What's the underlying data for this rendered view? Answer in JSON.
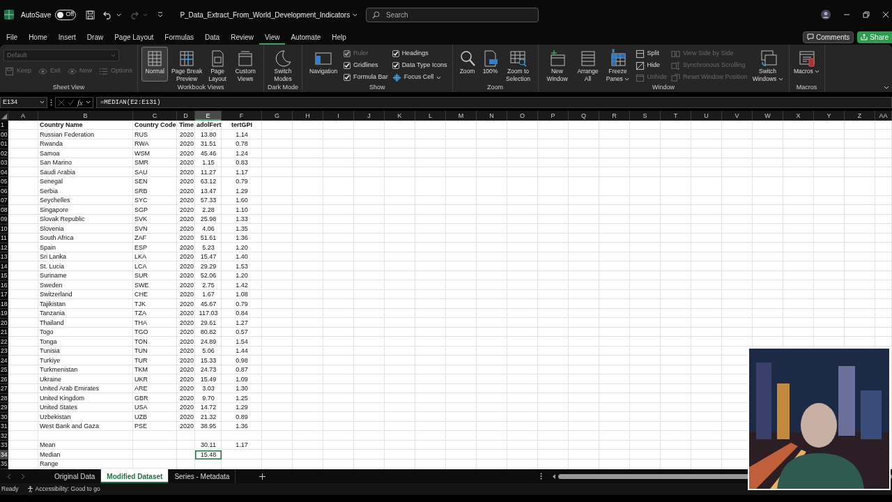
{
  "title_bar": {
    "autosave_label": "AutoSave",
    "autosave": {
      "on": false,
      "text": "Off"
    },
    "filename": "P_Data_Extract_From_World_Development_Indicators",
    "search": {
      "placeholder": "Search"
    }
  },
  "menu_tabs": [
    {
      "label": "File",
      "selected": false
    },
    {
      "label": "Home",
      "selected": false
    },
    {
      "label": "Insert",
      "selected": false
    },
    {
      "label": "Draw",
      "selected": false
    },
    {
      "label": "Page Layout",
      "selected": false
    },
    {
      "label": "Formulas",
      "selected": false
    },
    {
      "label": "Data",
      "selected": false
    },
    {
      "label": "Review",
      "selected": false
    },
    {
      "label": "View",
      "selected": true
    },
    {
      "label": "Automate",
      "selected": false
    },
    {
      "label": "Help",
      "selected": false
    }
  ],
  "comments_button": "Comments",
  "share_button": "Share",
  "ribbon": {
    "groups": [
      {
        "label": "Sheet View",
        "items": [
          {
            "kind": "select",
            "value": "Default",
            "disabled": true
          },
          {
            "kind": "small",
            "label": "Keep",
            "disabled": true
          },
          {
            "kind": "small",
            "label": "Exit",
            "disabled": true
          },
          {
            "kind": "small",
            "label": "New",
            "disabled": true
          },
          {
            "kind": "small",
            "label": "Options",
            "disabled": true
          }
        ]
      },
      {
        "label": "Workbook Views",
        "items": [
          {
            "kind": "large",
            "label": "Normal",
            "selected": true
          },
          {
            "kind": "large",
            "label": "Page Break Preview",
            "selected": false
          },
          {
            "kind": "large",
            "label": "Page Layout",
            "selected": false
          },
          {
            "kind": "large",
            "label": "Custom Views",
            "selected": false
          }
        ]
      },
      {
        "label": "Dark Mode",
        "items": [
          {
            "kind": "large",
            "label": "Switch Modes"
          }
        ]
      },
      {
        "label": "Show",
        "items": [
          {
            "kind": "large",
            "label": "Navigation"
          },
          {
            "kind": "check",
            "label": "Ruler",
            "checked": true,
            "disabled": true
          },
          {
            "kind": "check",
            "label": "Gridlines",
            "checked": true
          },
          {
            "kind": "check",
            "label": "Formula Bar",
            "checked": true
          },
          {
            "kind": "check",
            "label": "Headings",
            "checked": true
          },
          {
            "kind": "check",
            "label": "Data Type Icons",
            "checked": true
          },
          {
            "kind": "small",
            "label": "Focus Cell",
            "has_menu": true
          }
        ]
      },
      {
        "label": "Zoom",
        "items": [
          {
            "kind": "large",
            "label": "Zoom"
          },
          {
            "kind": "large",
            "label": "100%"
          },
          {
            "kind": "large",
            "label": "Zoom to Selection"
          }
        ]
      },
      {
        "label": "Window",
        "items": [
          {
            "kind": "large",
            "label": "New Window"
          },
          {
            "kind": "large",
            "label": "Arrange All"
          },
          {
            "kind": "large",
            "label": "Freeze Panes",
            "has_menu": true
          },
          {
            "kind": "small",
            "label": "Split"
          },
          {
            "kind": "small",
            "label": "Hide"
          },
          {
            "kind": "small",
            "label": "Unhide",
            "disabled": true
          },
          {
            "kind": "small",
            "label": "View Side by Side",
            "disabled": true
          },
          {
            "kind": "small",
            "label": "Synchronous Scrolling",
            "disabled": true
          },
          {
            "kind": "small",
            "label": "Reset Window Position",
            "disabled": true
          },
          {
            "kind": "large",
            "label": "Switch Windows",
            "has_menu": true
          }
        ]
      },
      {
        "label": "Macros",
        "items": [
          {
            "kind": "large",
            "label": "Macros",
            "has_menu": true
          }
        ]
      }
    ]
  },
  "formula_bar": {
    "name_box": "E134",
    "function_button": "fx",
    "formula": "=MEDIAN(E2:E131)"
  },
  "sheet": {
    "columns": [
      {
        "label": "A",
        "selected": false
      },
      {
        "label": "B",
        "selected": false
      },
      {
        "label": "C",
        "selected": false
      },
      {
        "label": "D",
        "selected": false
      },
      {
        "label": "E",
        "selected": true
      },
      {
        "label": "F",
        "selected": false
      },
      {
        "label": "G",
        "selected": false
      },
      {
        "label": "H",
        "selected": false
      },
      {
        "label": "I",
        "selected": false
      },
      {
        "label": "J",
        "selected": false
      },
      {
        "label": "K",
        "selected": false
      },
      {
        "label": "L",
        "selected": false
      },
      {
        "label": "M",
        "selected": false
      },
      {
        "label": "N",
        "selected": false
      },
      {
        "label": "O",
        "selected": false
      },
      {
        "label": "P",
        "selected": false
      },
      {
        "label": "Q",
        "selected": false
      },
      {
        "label": "R",
        "selected": false
      },
      {
        "label": "S",
        "selected": false
      },
      {
        "label": "T",
        "selected": false
      },
      {
        "label": "U",
        "selected": false
      },
      {
        "label": "V",
        "selected": false
      },
      {
        "label": "W",
        "selected": false
      },
      {
        "label": "X",
        "selected": false
      },
      {
        "label": "Y",
        "selected": false
      },
      {
        "label": "Z",
        "selected": false
      },
      {
        "label": "AA",
        "selected": false
      }
    ],
    "rows": [
      {
        "number": "1",
        "selected": false,
        "kind": "header",
        "B": "Country Name",
        "C": "Country Code",
        "D": "Time",
        "E": "adolFert",
        "F": "tertGPI"
      },
      {
        "number": "00",
        "selected": false,
        "B": "Russian Federation",
        "C": "RUS",
        "D": "2020",
        "E": "13.80",
        "F": "1.14"
      },
      {
        "number": "01",
        "selected": false,
        "B": "Rwanda",
        "C": "RWA",
        "D": "2020",
        "E": "31.51",
        "F": "0.78"
      },
      {
        "number": "02",
        "selected": false,
        "B": "Samoa",
        "C": "WSM",
        "D": "2020",
        "E": "45.46",
        "F": "1.24"
      },
      {
        "number": "03",
        "selected": false,
        "B": "San Marino",
        "C": "SMR",
        "D": "2020",
        "E": "1.15",
        "F": "0.83"
      },
      {
        "number": "04",
        "selected": false,
        "B": "Saudi Arabia",
        "C": "SAU",
        "D": "2020",
        "E": "11.27",
        "F": "1.17"
      },
      {
        "number": "05",
        "selected": false,
        "B": "Senegal",
        "C": "SEN",
        "D": "2020",
        "E": "63.12",
        "F": "0.79"
      },
      {
        "number": "06",
        "selected": false,
        "B": "Serbia",
        "C": "SRB",
        "D": "2020",
        "E": "13.47",
        "F": "1.29"
      },
      {
        "number": "07",
        "selected": false,
        "B": "Seychelles",
        "C": "SYC",
        "D": "2020",
        "E": "57.33",
        "F": "1.60"
      },
      {
        "number": "08",
        "selected": false,
        "B": "Singapore",
        "C": "SGP",
        "D": "2020",
        "E": "2.28",
        "F": "1.10"
      },
      {
        "number": "09",
        "selected": false,
        "B": "Slovak Republic",
        "C": "SVK",
        "D": "2020",
        "E": "25.98",
        "F": "1.33"
      },
      {
        "number": "10",
        "selected": false,
        "B": "Slovenia",
        "C": "SVN",
        "D": "2020",
        "E": "4.06",
        "F": "1.35"
      },
      {
        "number": "11",
        "selected": false,
        "B": "South Africa",
        "C": "ZAF",
        "D": "2020",
        "E": "51.61",
        "F": "1.36"
      },
      {
        "number": "12",
        "selected": false,
        "B": "Spain",
        "C": "ESP",
        "D": "2020",
        "E": "5.23",
        "F": "1.20"
      },
      {
        "number": "13",
        "selected": false,
        "B": "Sri Lanka",
        "C": "LKA",
        "D": "2020",
        "E": "15.47",
        "F": "1.40"
      },
      {
        "number": "14",
        "selected": false,
        "B": "St. Lucia",
        "C": "LCA",
        "D": "2020",
        "E": "29.29",
        "F": "1.53"
      },
      {
        "number": "15",
        "selected": false,
        "B": "Suriname",
        "C": "SUR",
        "D": "2020",
        "E": "52.06",
        "F": "1.20"
      },
      {
        "number": "16",
        "selected": false,
        "B": "Sweden",
        "C": "SWE",
        "D": "2020",
        "E": "2.75",
        "F": "1.42"
      },
      {
        "number": "17",
        "selected": false,
        "B": "Switzerland",
        "C": "CHE",
        "D": "2020",
        "E": "1.67",
        "F": "1.08"
      },
      {
        "number": "18",
        "selected": false,
        "B": "Tajikistan",
        "C": "TJK",
        "D": "2020",
        "E": "45.67",
        "F": "0.79"
      },
      {
        "number": "19",
        "selected": false,
        "B": "Tanzania",
        "C": "TZA",
        "D": "2020",
        "E": "117.03",
        "F": "0.84"
      },
      {
        "number": "20",
        "selected": false,
        "B": "Thailand",
        "C": "THA",
        "D": "2020",
        "E": "29.61",
        "F": "1.27"
      },
      {
        "number": "21",
        "selected": false,
        "B": "Togo",
        "C": "TGO",
        "D": "2020",
        "E": "80.82",
        "F": "0.57"
      },
      {
        "number": "22",
        "selected": false,
        "B": "Tonga",
        "C": "TON",
        "D": "2020",
        "E": "24.89",
        "F": "1.54"
      },
      {
        "number": "23",
        "selected": false,
        "B": "Tunisia",
        "C": "TUN",
        "D": "2020",
        "E": "5.06",
        "F": "1.44"
      },
      {
        "number": "24",
        "selected": false,
        "B": "Turkiye",
        "C": "TUR",
        "D": "2020",
        "E": "15.33",
        "F": "0.98"
      },
      {
        "number": "25",
        "selected": false,
        "B": "Turkmenistan",
        "C": "TKM",
        "D": "2020",
        "E": "24.73",
        "F": "0.87"
      },
      {
        "number": "26",
        "selected": false,
        "B": "Ukraine",
        "C": "UKR",
        "D": "2020",
        "E": "15.49",
        "F": "1.09"
      },
      {
        "number": "27",
        "selected": false,
        "B": "United Arab Emirates",
        "C": "ARE",
        "D": "2020",
        "E": "3.03",
        "F": "1.30"
      },
      {
        "number": "28",
        "selected": false,
        "B": "United Kingdom",
        "C": "GBR",
        "D": "2020",
        "E": "9.70",
        "F": "1.25"
      },
      {
        "number": "29",
        "selected": false,
        "B": "United States",
        "C": "USA",
        "D": "2020",
        "E": "14.72",
        "F": "1.29"
      },
      {
        "number": "30",
        "selected": false,
        "B": "Uzbekistan",
        "C": "UZB",
        "D": "2020",
        "E": "21.32",
        "F": "0.89"
      },
      {
        "number": "31",
        "selected": false,
        "B": "West Bank and Gaza",
        "C": "PSE",
        "D": "2020",
        "E": "38.95",
        "F": "1.36"
      },
      {
        "number": "32",
        "selected": false
      },
      {
        "number": "33",
        "selected": false,
        "B": "Mean",
        "E": "30.11",
        "F": "1.17"
      },
      {
        "number": "34",
        "selected": true,
        "B": "Median",
        "E": "15.48"
      },
      {
        "number": "35",
        "selected": false,
        "B": "Range"
      }
    ]
  },
  "sheet_tabs": [
    {
      "label": "Original Data",
      "selected": false
    },
    {
      "label": "Modified Dataset",
      "selected": true
    },
    {
      "label": "Series - Metadata",
      "selected": false
    }
  ],
  "status_bar": {
    "mode": "Ready",
    "accessibility": "Accessibility: Good to go"
  }
}
